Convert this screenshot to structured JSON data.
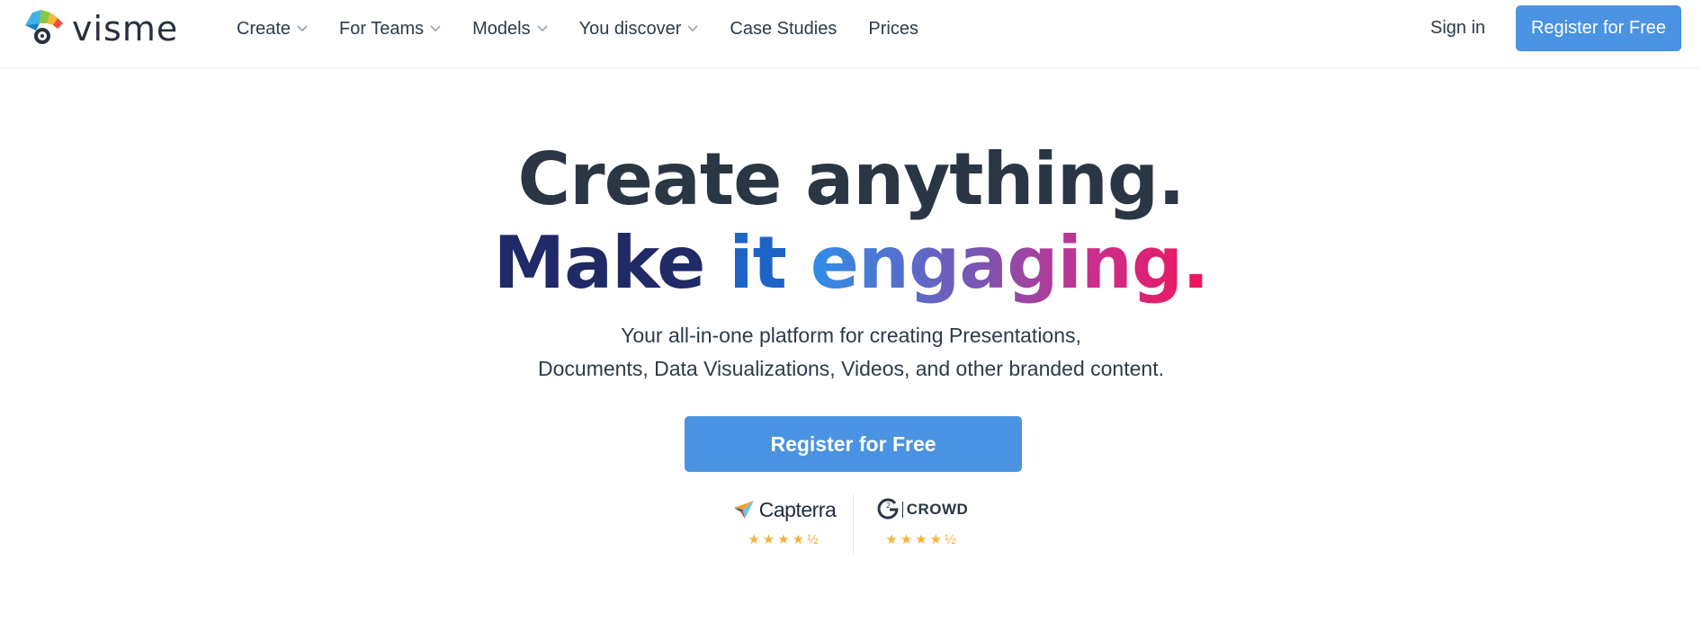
{
  "brand": {
    "name": "visme",
    "logo_icon": "visme-chameleon-logo"
  },
  "nav": {
    "items": [
      {
        "label": "Create",
        "has_dropdown": true
      },
      {
        "label": "For Teams",
        "has_dropdown": true
      },
      {
        "label": "Models",
        "has_dropdown": true
      },
      {
        "label": "You discover",
        "has_dropdown": true
      },
      {
        "label": "Case Studies",
        "has_dropdown": false
      },
      {
        "label": "Prices",
        "has_dropdown": false
      }
    ],
    "sign_in": "Sign in",
    "register": "Register for Free"
  },
  "hero": {
    "line1": "Create anything.",
    "line2_part1": "Make",
    "line2_part2": "it",
    "line2_part3": "engaging.",
    "subtitle_line1": "Your all-in-one platform for creating Presentations,",
    "subtitle_line2": "Documents, Data Visualizations, Videos, and other branded content.",
    "cta": "Register for Free"
  },
  "ratings": [
    {
      "name": "Capterra",
      "stars": "★★★★½",
      "icon": "capterra-logo-icon"
    },
    {
      "name": "CROWD",
      "prefix": "G2",
      "stars": "★★★★½",
      "icon": "g2-logo-icon"
    }
  ],
  "colors": {
    "accent": "#4a93e2",
    "heading": "#2b3645",
    "make": "#1f2a66",
    "it": "#1e64c8",
    "gradient_start": "#2e8ee8",
    "gradient_end": "#f0145a",
    "stars": "#f2b437"
  }
}
